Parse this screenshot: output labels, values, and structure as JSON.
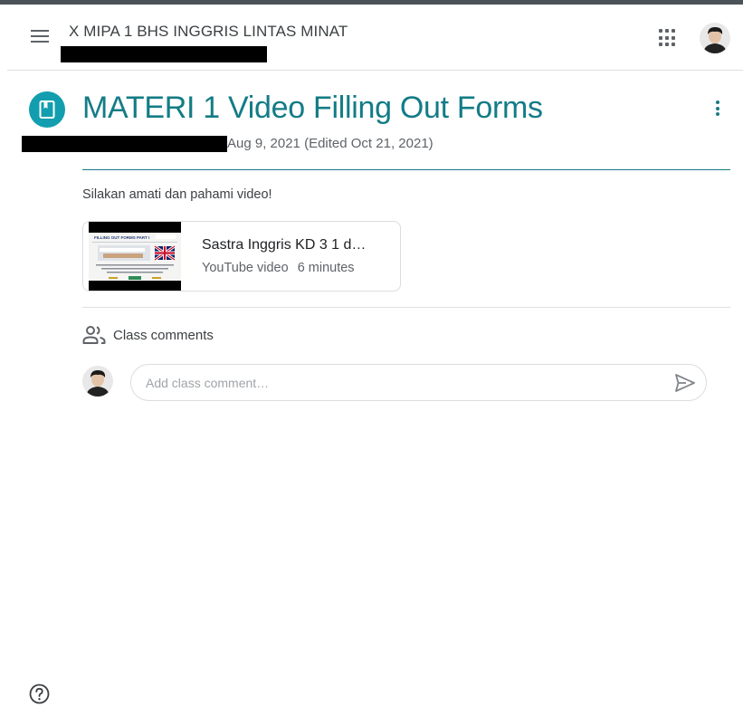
{
  "header": {
    "class_name": "X MIPA 1 BHS INGGRIS LINTAS MINAT",
    "menu_icon": "hamburger-menu-icon",
    "apps_icon": "google-apps-grid-icon"
  },
  "post": {
    "icon": "material-book-icon",
    "title": "MATERI 1 Video Filling Out Forms",
    "date": "Aug 9, 2021 (Edited Oct 21, 2021)",
    "description": "Silakan amati dan pahami video!"
  },
  "attachment": {
    "title": "Sastra Inggris KD 3 1 d…",
    "type": "YouTube video",
    "duration": "6 minutes",
    "thumbnail_heading": "FILLING OUT FORMS PART I"
  },
  "comments": {
    "label": "Class comments",
    "placeholder": "Add class comment…",
    "icon": "people-icon",
    "send_icon": "send-icon"
  },
  "colors": {
    "accent": "#137c86",
    "material_icon_bg": "#129eaf",
    "text": "#3c4043",
    "secondary_text": "#5f6368"
  },
  "help_icon": "help-circle-icon"
}
